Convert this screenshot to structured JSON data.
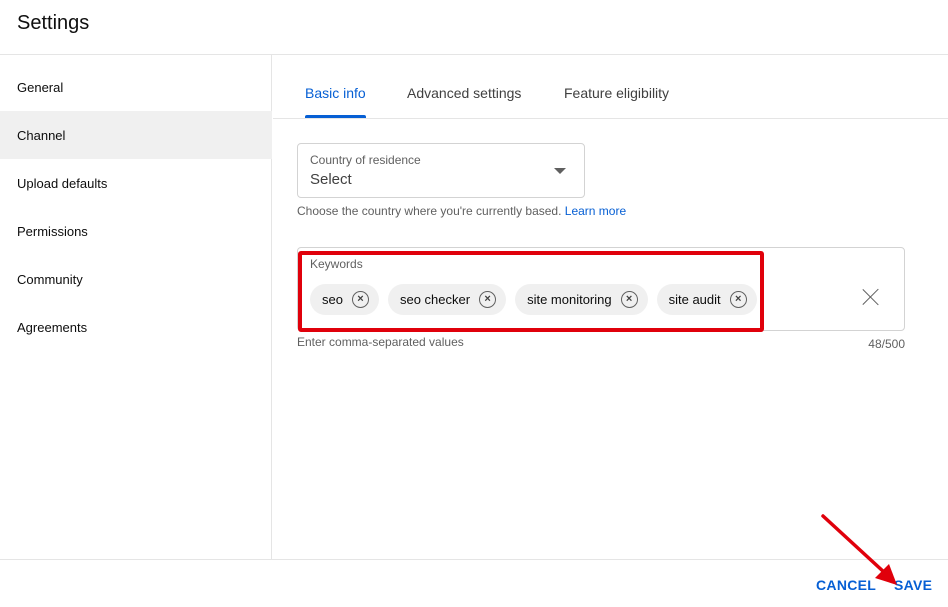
{
  "header": {
    "title": "Settings"
  },
  "sidebar": {
    "active": "Channel",
    "items": [
      {
        "label": "General"
      },
      {
        "label": "Channel"
      },
      {
        "label": "Upload defaults"
      },
      {
        "label": "Permissions"
      },
      {
        "label": "Community"
      },
      {
        "label": "Agreements"
      }
    ]
  },
  "tabs": [
    {
      "label": "Basic info",
      "active": true
    },
    {
      "label": "Advanced settings",
      "active": false
    },
    {
      "label": "Feature eligibility",
      "active": false
    }
  ],
  "country": {
    "label": "Country of residence",
    "value": "Select",
    "help_text": "Choose the country where you're currently based.",
    "help_link": "Learn more"
  },
  "keywords": {
    "label": "Keywords",
    "chips": [
      "seo",
      "seo checker",
      "site monitoring",
      "site audit"
    ],
    "remove_icon": "close-circle-icon",
    "clear_icon": "close-icon",
    "help_text": "Enter comma-separated values",
    "count": "48/500"
  },
  "footer": {
    "cancel_label": "CANCEL",
    "save_label": "SAVE"
  },
  "colors": {
    "accent": "#065fd4",
    "annotation": "#e0000b",
    "active_item_bg": "#f0f0f0"
  }
}
